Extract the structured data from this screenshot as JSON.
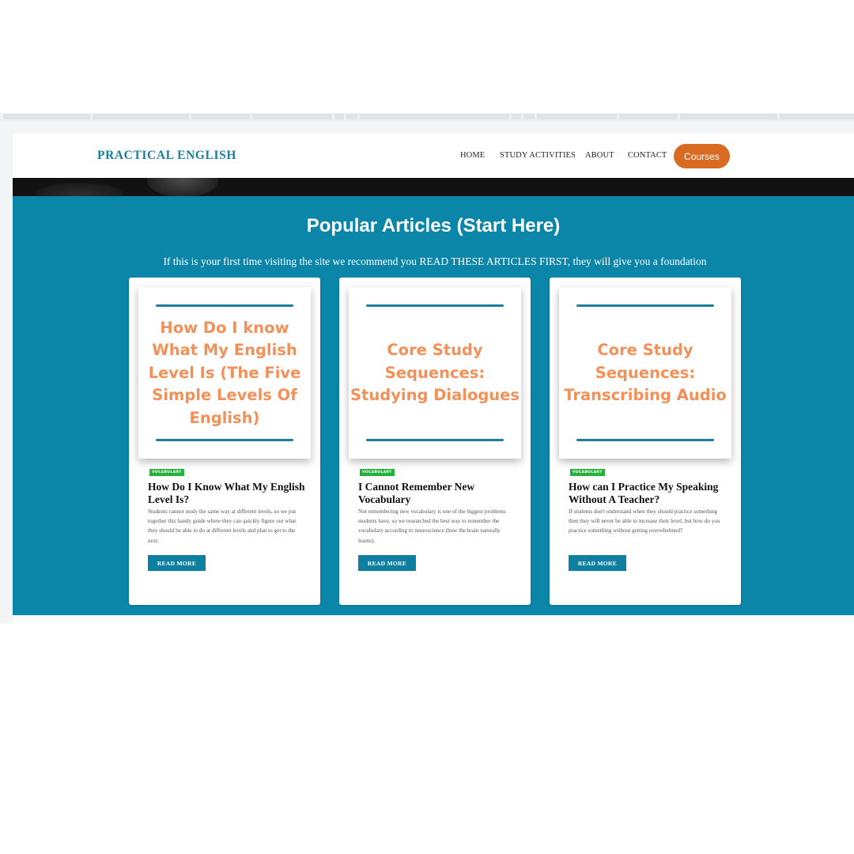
{
  "colors": {
    "brand": "#1b7e9c",
    "section_bg": "#0b86a8",
    "courses_button": "#d86a21",
    "thumbnail_text": "#f39058",
    "tag_bg": "#22b33a"
  },
  "header": {
    "logo": "PRACTICAL ENGLISH",
    "nav": [
      "HOME",
      "STUDY ACTIVITIES",
      "ABOUT",
      "CONTACT"
    ],
    "cta": "Courses"
  },
  "section": {
    "title": "Popular Articles (Start Here)",
    "subtitle": "If this is your first time visiting the site we recommend you READ THESE ARTICLES FIRST, they will give you a foundation"
  },
  "articles": [
    {
      "thumbnail_text": "How Do I know What My English Level Is (The Five Simple Levels Of English)",
      "tag": "VOCABULARY",
      "title": "How Do I Know What My English Level Is?",
      "excerpt": "Students cannot study the same way at different levels, so we put together this handy guide where they can quickly figure out what they should be able to do at different levels and plan to get to the next.",
      "button": "READ MORE"
    },
    {
      "thumbnail_text": "Core Study Sequences: Studying Dialogues",
      "tag": "VOCABULARY",
      "title": "I Cannot Remember New Vocabulary",
      "excerpt": "Not remembering new vocabulary is one of the biggest problems students have, so we researched the best way to remember the vocabulary according to neuroscience (how the brain naturally learns).",
      "button": "READ MORE"
    },
    {
      "thumbnail_text": "Core Study Sequences: Transcribing Audio",
      "tag": "VOCABULARY",
      "title": "How can I Practice My Speaking Without A Teacher?",
      "excerpt": "If students don't understand when they should practice something then they will never be able to increase their level, but how do you practice something without getting overwhelmed?",
      "button": "READ MORE"
    }
  ]
}
